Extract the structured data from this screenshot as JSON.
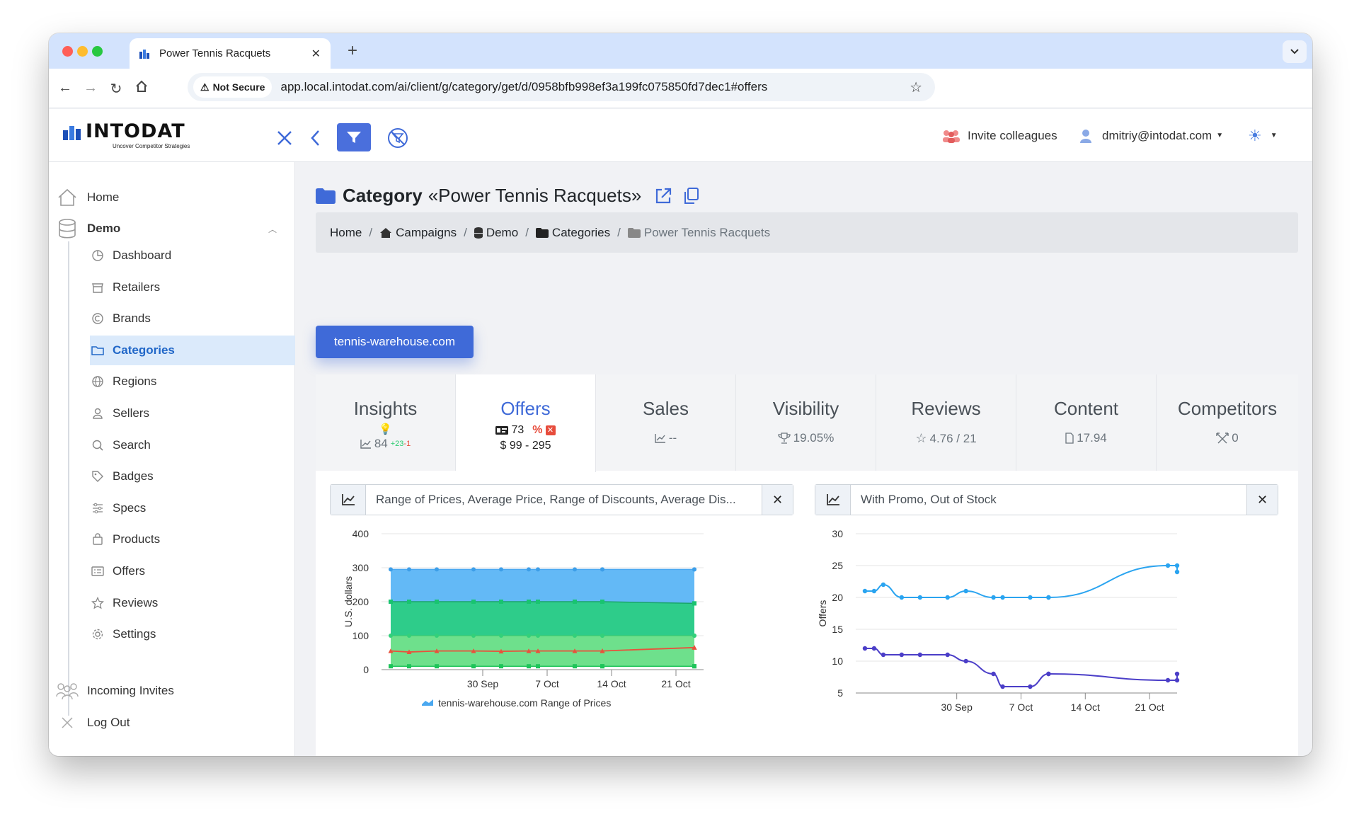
{
  "browser": {
    "tab_title": "Power Tennis Racquets",
    "security": "Not Secure",
    "url": "app.local.intodat.com/ai/client/g/category/get/d/0958bfb998ef3a199fc075850fd7dec1#offers"
  },
  "header": {
    "logo_text": "INTODAT",
    "logo_tagline": "Uncover Competitor Strategies",
    "invite_label": "Invite colleagues",
    "user_email": "dmitriy@intodat.com",
    "colors": {
      "brand": "#3f6ad8",
      "filter_button": "#4a6fdc"
    }
  },
  "sidebar": {
    "home": "Home",
    "group": "Demo",
    "items": [
      {
        "label": "Dashboard",
        "icon": "dashboard-icon"
      },
      {
        "label": "Retailers",
        "icon": "store-icon"
      },
      {
        "label": "Brands",
        "icon": "copyright-icon"
      },
      {
        "label": "Categories",
        "icon": "folder-icon",
        "active": true
      },
      {
        "label": "Regions",
        "icon": "globe-icon"
      },
      {
        "label": "Sellers",
        "icon": "user-icon"
      },
      {
        "label": "Search",
        "icon": "search-icon"
      },
      {
        "label": "Badges",
        "icon": "tag-icon"
      },
      {
        "label": "Specs",
        "icon": "sliders-icon"
      },
      {
        "label": "Products",
        "icon": "bag-icon"
      },
      {
        "label": "Offers",
        "icon": "list-icon"
      },
      {
        "label": "Reviews",
        "icon": "star-icon"
      },
      {
        "label": "Settings",
        "icon": "gear-icon"
      }
    ],
    "incoming": "Incoming Invites",
    "logout": "Log Out"
  },
  "page": {
    "title_prefix": "Category",
    "title_name": "«Power Tennis Racquets»",
    "breadcrumb": {
      "home": "Home",
      "campaigns": "Campaigns",
      "demo": "Demo",
      "categories": "Categories",
      "current": "Power Tennis Racquets"
    },
    "retailer_button": "tennis-warehouse.com"
  },
  "tabs": {
    "insights": {
      "label": "Insights",
      "count": "84",
      "delta_up": "+23",
      "delta_down": "-1"
    },
    "offers": {
      "label": "Offers",
      "count": "73",
      "price_range": "$ 99 - 295"
    },
    "sales": {
      "label": "Sales",
      "value": "--"
    },
    "visibility": {
      "label": "Visibility",
      "value": "19.05%"
    },
    "reviews": {
      "label": "Reviews",
      "value": "4.76 / 21"
    },
    "content": {
      "label": "Content",
      "value": "17.94"
    },
    "competitors": {
      "label": "Competitors",
      "value": "0"
    }
  },
  "left_panel": {
    "selector": "Range of Prices, Average Price, Range of Discounts, Average Dis..."
  },
  "right_panel": {
    "selector": "With Promo, Out of Stock"
  },
  "chart_data": [
    {
      "type": "area",
      "ylabel": "U.S. dollars",
      "ylim": [
        0,
        400
      ],
      "yticks": [
        0,
        100,
        200,
        300,
        400
      ],
      "xticks": [
        "30 Sep",
        "7 Oct",
        "14 Oct",
        "21 Oct"
      ],
      "x": [
        "2024-09-20",
        "2024-09-22",
        "2024-09-25",
        "2024-09-29",
        "2024-10-02",
        "2024-10-05",
        "2024-10-06",
        "2024-10-10",
        "2024-10-13",
        "2024-10-13",
        "2024-10-23",
        "2024-10-23"
      ],
      "legend": "tennis-warehouse.com Range of Prices",
      "series": [
        {
          "name": "tennis-warehouse.com Range of Prices",
          "color": "#5bb5f5",
          "low": [
            99,
            99,
            99,
            99,
            99,
            99,
            99,
            99,
            99,
            99,
            99,
            99
          ],
          "high": [
            295,
            295,
            295,
            295,
            295,
            295,
            295,
            295,
            295,
            295,
            295,
            295
          ]
        },
        {
          "values": [
            200,
            200,
            200,
            200,
            200,
            200,
            200,
            200,
            200,
            200,
            195,
            195
          ],
          "color": "#2ecc8a"
        },
        {
          "values": [
            55,
            52,
            55,
            55,
            54,
            55,
            55,
            55,
            55,
            55,
            65,
            65
          ],
          "color": "#e8523c"
        },
        {
          "low": [
            10,
            10,
            10,
            10,
            10,
            10,
            10,
            10,
            10,
            10,
            10,
            10
          ],
          "high": [
            100,
            100,
            100,
            100,
            100,
            100,
            100,
            100,
            100,
            100,
            100,
            100
          ],
          "color": "#6ee08c"
        }
      ]
    },
    {
      "type": "line",
      "ylabel": "Offers",
      "ylim": [
        5,
        30
      ],
      "yticks": [
        5,
        10,
        15,
        20,
        25,
        30
      ],
      "xticks": [
        "30 Sep",
        "7 Oct",
        "14 Oct",
        "21 Oct"
      ],
      "x": [
        "2024-09-20",
        "2024-09-21",
        "2024-09-22",
        "2024-09-24",
        "2024-09-26",
        "2024-09-29",
        "2024-10-01",
        "2024-10-04",
        "2024-10-05",
        "2024-10-08",
        "2024-10-10",
        "2024-10-10",
        "2024-10-23",
        "2024-10-24",
        "2024-10-24"
      ],
      "series": [
        {
          "values": [
            21,
            21,
            22,
            20,
            20,
            20,
            21,
            20,
            20,
            20,
            20,
            20,
            25,
            25,
            24
          ],
          "color": "#2aa4f0"
        },
        {
          "values": [
            12,
            12,
            11,
            11,
            11,
            11,
            10,
            8,
            6,
            6,
            8,
            8,
            7,
            7,
            8
          ],
          "color": "#4b3ec8"
        }
      ]
    }
  ]
}
